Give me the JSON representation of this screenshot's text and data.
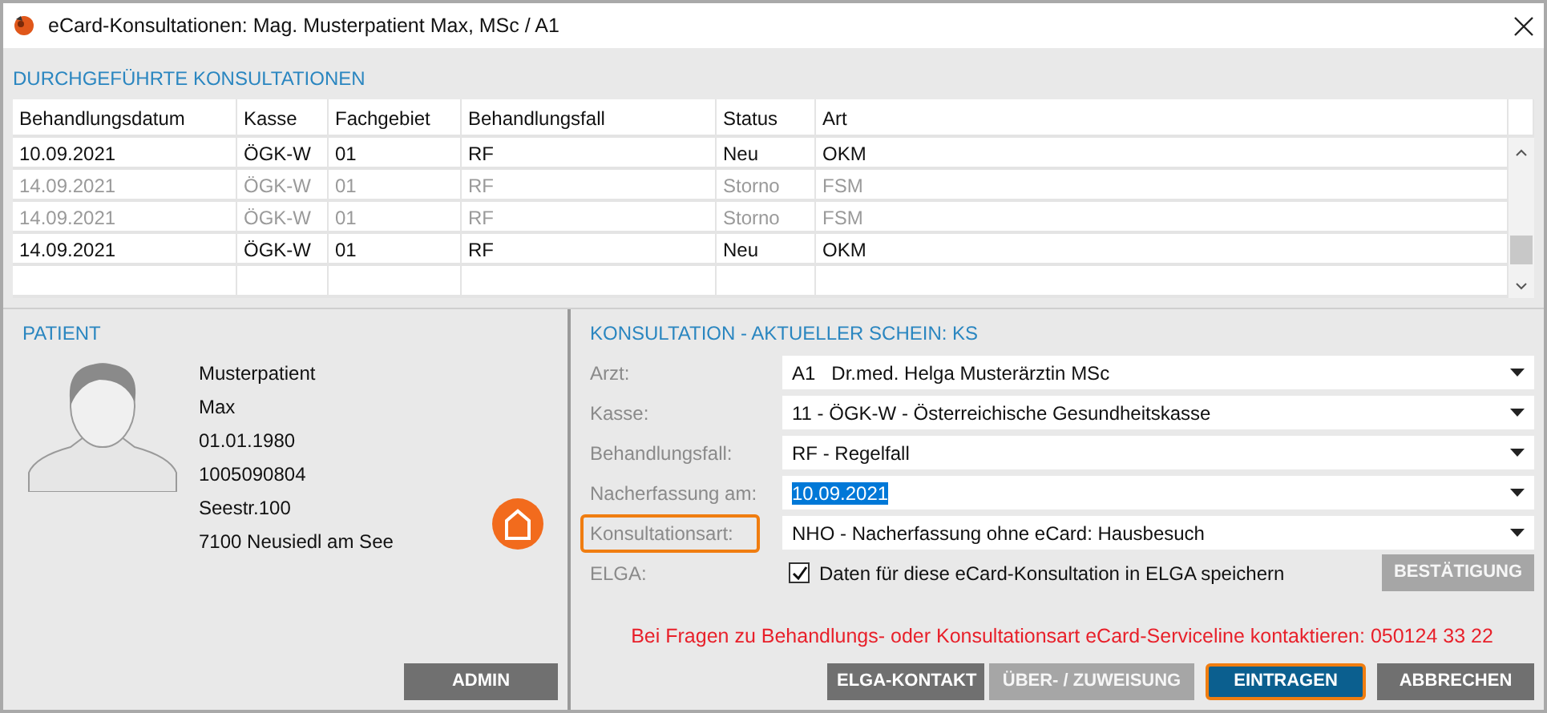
{
  "window": {
    "title": "eCard-Konsultationen: Mag. Musterpatient Max, MSc / A1"
  },
  "history": {
    "heading": "DURCHGEFÜHRTE KONSULTATIONEN",
    "columns": [
      "Behandlungsdatum",
      "Kasse",
      "Fachgebiet",
      "Behandlungsfall",
      "Status",
      "Art"
    ],
    "rows": [
      {
        "cells": [
          "10.09.2021",
          "ÖGK-W",
          "01",
          "RF",
          "Neu",
          "OKM"
        ],
        "disabled": false
      },
      {
        "cells": [
          "14.09.2021",
          "ÖGK-W",
          "01",
          "RF",
          "Storno",
          "FSM"
        ],
        "disabled": true
      },
      {
        "cells": [
          "14.09.2021",
          "ÖGK-W",
          "01",
          "RF",
          "Storno",
          "FSM"
        ],
        "disabled": true
      },
      {
        "cells": [
          "14.09.2021",
          "ÖGK-W",
          "01",
          "RF",
          "Neu",
          "OKM"
        ],
        "disabled": false
      }
    ]
  },
  "patient": {
    "heading": "PATIENT",
    "lines": [
      "Musterpatient",
      "Max",
      "01.01.1980",
      "1005090804",
      "Seestr.100",
      "7100 Neusiedl am See"
    ],
    "buttons": [
      {
        "label": "ADMIN",
        "kind": "secondary",
        "disabled": false,
        "highlighted": false
      }
    ]
  },
  "consultation": {
    "heading": "KONSULTATION - AKTUELLER SCHEIN: KS",
    "fields": [
      {
        "kind": "select",
        "label": "Arzt:",
        "value": "A1   Dr.med. Helga Musterärztin MSc",
        "highlighted": false,
        "value_selected": false
      },
      {
        "kind": "select",
        "label": "Kasse:",
        "value": "11 - ÖGK-W - Österreichische Gesundheitskasse",
        "highlighted": false,
        "value_selected": false
      },
      {
        "kind": "select",
        "label": "Behandlungsfall:",
        "value": "RF - Regelfall",
        "highlighted": false,
        "value_selected": false
      },
      {
        "kind": "select",
        "label": "Nacherfassung am:",
        "value": "10.09.2021",
        "highlighted": false,
        "value_selected": true
      },
      {
        "kind": "select",
        "label": "Konsultationsart:",
        "value": "NHO - Nacherfassung ohne eCard: Hausbesuch",
        "highlighted": true,
        "value_selected": false
      },
      {
        "kind": "checkbox",
        "label": "ELGA:",
        "value": "Daten für diese eCard-Konsultation in ELGA speichern",
        "checked": true,
        "highlighted": false,
        "button": {
          "label": "BESTÄTIGUNG",
          "kind": "secondary",
          "disabled": true,
          "highlighted": false
        }
      }
    ],
    "notice": "Bei Fragen zu Behandlungs- oder Konsultationsart eCard-Serviceline kontaktieren: 050124 33 22",
    "buttons": [
      {
        "label": "ELGA-KONTAKT",
        "kind": "secondary",
        "disabled": false,
        "highlighted": false
      },
      {
        "label": "ÜBER- / ZUWEISUNG",
        "kind": "secondary",
        "disabled": true,
        "highlighted": false
      },
      {
        "label": "EINTRAGEN",
        "kind": "primary",
        "disabled": false,
        "highlighted": true
      },
      {
        "label": "ABBRECHEN",
        "kind": "secondary",
        "disabled": false,
        "highlighted": false
      }
    ]
  }
}
